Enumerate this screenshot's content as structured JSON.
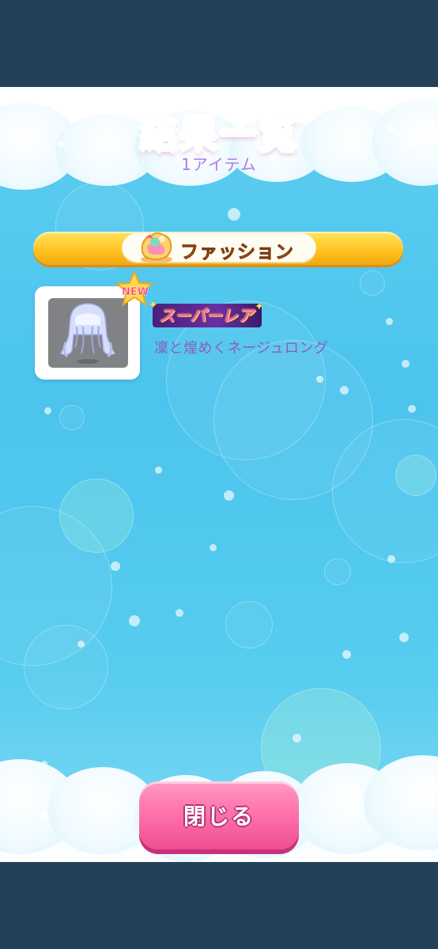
{
  "header": {
    "title": "結果一覧",
    "subtitle": "1アイテム"
  },
  "category": {
    "label": "ファッション",
    "icon": "clothes-bundle-icon"
  },
  "items": [
    {
      "badge": "NEW",
      "rarity": "スーパーレア",
      "name": "凜と煌めくネージュロング",
      "thumbnail_icon": "long-hair-icon"
    }
  ],
  "footer": {
    "close_label": "閉じる"
  },
  "colors": {
    "frame_background": "#23415a",
    "sky": "#4cc4ee",
    "category_bar": "#ffc21f",
    "close_button": "#ff73ad",
    "rarity_text": "#ff5ea8",
    "item_name": "#8a5ec0"
  }
}
